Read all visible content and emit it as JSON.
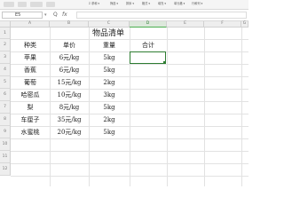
{
  "ribbon": {
    "labels": [
      "Σ 求和 ▾",
      "筛选 ▾",
      "排序 ▾",
      "格式 ▾",
      "填充 ▾",
      "单元格 ▾",
      "行和列 ▾"
    ]
  },
  "formula_bar": {
    "cell_ref": "E5",
    "fx_symbol": "fx",
    "zoom_symbol": "Q",
    "value": ""
  },
  "grid": {
    "columns": [
      "A",
      "B",
      "C",
      "D",
      "E",
      "F",
      "G"
    ],
    "active_column": "D",
    "rows": [
      "1",
      "2",
      "3",
      "4",
      "5",
      "6",
      "7",
      "8",
      "9",
      "10",
      "11",
      "12"
    ]
  },
  "sheet": {
    "title": "物品清单",
    "headers": {
      "kind": "种类",
      "price": "单价",
      "weight": "重量",
      "total": "合计"
    },
    "items": [
      {
        "kind": "苹果",
        "price": "6元/kg",
        "weight": "5kg"
      },
      {
        "kind": "香蕉",
        "price": "6元/kg",
        "weight": "5kg"
      },
      {
        "kind": "葡萄",
        "price": "15元/kg",
        "weight": "2kg"
      },
      {
        "kind": "哈密瓜",
        "price": "10元/kg",
        "weight": "3kg"
      },
      {
        "kind": "梨",
        "price": "8元/kg",
        "weight": "5kg"
      },
      {
        "kind": "车厘子",
        "price": "35元/kg",
        "weight": "2kg"
      },
      {
        "kind": "水蜜桃",
        "price": "20元/kg",
        "weight": "5kg"
      }
    ]
  },
  "colors": {
    "selection": "#2e7d32",
    "gridline": "#e2e2e2",
    "header_bg": "#eeeeee"
  }
}
